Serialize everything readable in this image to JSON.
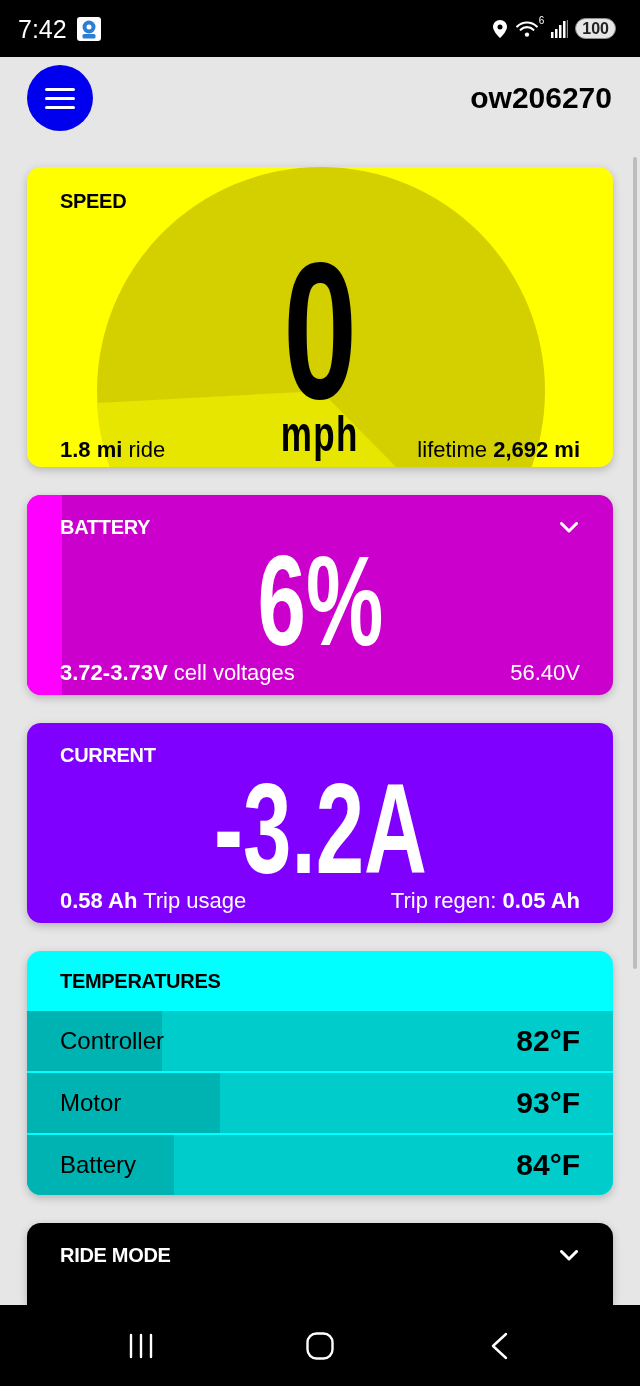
{
  "status_bar": {
    "time": "7:42",
    "wifi_badge": "6",
    "battery": "100"
  },
  "header": {
    "title": "ow206270"
  },
  "cards": [
    {
      "kind": "speed",
      "color": "#ffff00",
      "label": "SPEED",
      "value": "0",
      "unit": "mph",
      "left": "**1.8 mi** ride",
      "right": "lifetime **2,692 mi**"
    },
    {
      "kind": "battery",
      "color": "#cc00cc",
      "label": "BATTERY",
      "collapsible": true,
      "level": 0.06,
      "value": "6%",
      "left": "**3.72-3.73V** cell voltages",
      "right": "56.40V"
    },
    {
      "kind": "current",
      "color": "#8000ff",
      "label": "CURRENT",
      "value": "-3.2A",
      "left": "**0.58 Ah** Trip usage",
      "right": "Trip regen: **0.05 Ah**"
    },
    {
      "kind": "temperatures",
      "color": "#00ffff",
      "label": "TEMPERATURES",
      "rows": [
        {
          "name": "Controller",
          "reading": "82°F",
          "level": 0.23
        },
        {
          "name": "Motor",
          "reading": "93°F",
          "level": 0.33
        },
        {
          "name": "Battery",
          "reading": "84°F",
          "level": 0.25
        }
      ]
    },
    {
      "kind": "ride_mode",
      "color": "#000000",
      "label": "RIDE MODE",
      "collapsible": true
    }
  ]
}
